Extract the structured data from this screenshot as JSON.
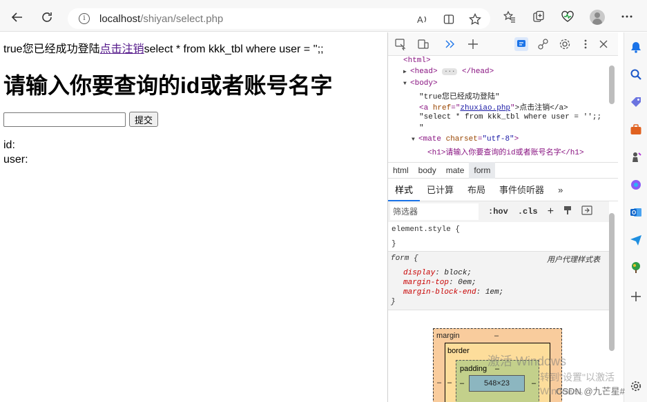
{
  "browser": {
    "url_host": "localhost",
    "url_path": "/shiyan/select.php"
  },
  "page": {
    "line1_prefix": "true您已经成功登陆",
    "logout_link": "点击注销",
    "line1_suffix": "select * from kkk_tbl where user = '';;",
    "heading": "请输入你要查询的id或者账号名字",
    "input_value": "",
    "submit_label": "提交",
    "id_label": "id:",
    "user_label": "user:"
  },
  "devtools": {
    "dom": {
      "html": "<html>",
      "head_open": "<head>",
      "head_close": "</head>",
      "body": "<body>",
      "text1": "\"true您已经成功登陆\"",
      "a_open": "<a ",
      "a_attr": "href",
      "a_val": "zhuxiao.php",
      "a_text": ">点击注销</a>",
      "text2": "\"select * from kkk_tbl where user = '';;",
      "text2_end": "\"",
      "mate_open": "<mate ",
      "mate_attr": "charset",
      "mate_val": "\"utf-8\"",
      "h1_line": "<h1>请输入你要查询的id或者账号名字</h1>"
    },
    "breadcrumbs": [
      "html",
      "body",
      "mate",
      "form"
    ],
    "style_tabs": [
      "样式",
      "已计算",
      "布局",
      "事件侦听器"
    ],
    "filter_placeholder": "筛选器",
    "hov": ":hov",
    "cls": ".cls",
    "element_style": "element.style {",
    "close_brace": "}",
    "form_selector": "form {",
    "user_agent": "用户代理样式表",
    "props": [
      {
        "name": "display",
        "value": "block;"
      },
      {
        "name": "margin-top",
        "value": "0em;"
      },
      {
        "name": "margin-block-end",
        "value": "1em;"
      }
    ],
    "box": {
      "margin": "margin",
      "border": "border",
      "padding": "padding",
      "dash": "–",
      "content": "548×23"
    }
  },
  "watermark": {
    "line1": "激活 Windows",
    "line2": "转到\"设置\"以激活 Windows。",
    "csdn": "CSDN @九芒星#"
  }
}
